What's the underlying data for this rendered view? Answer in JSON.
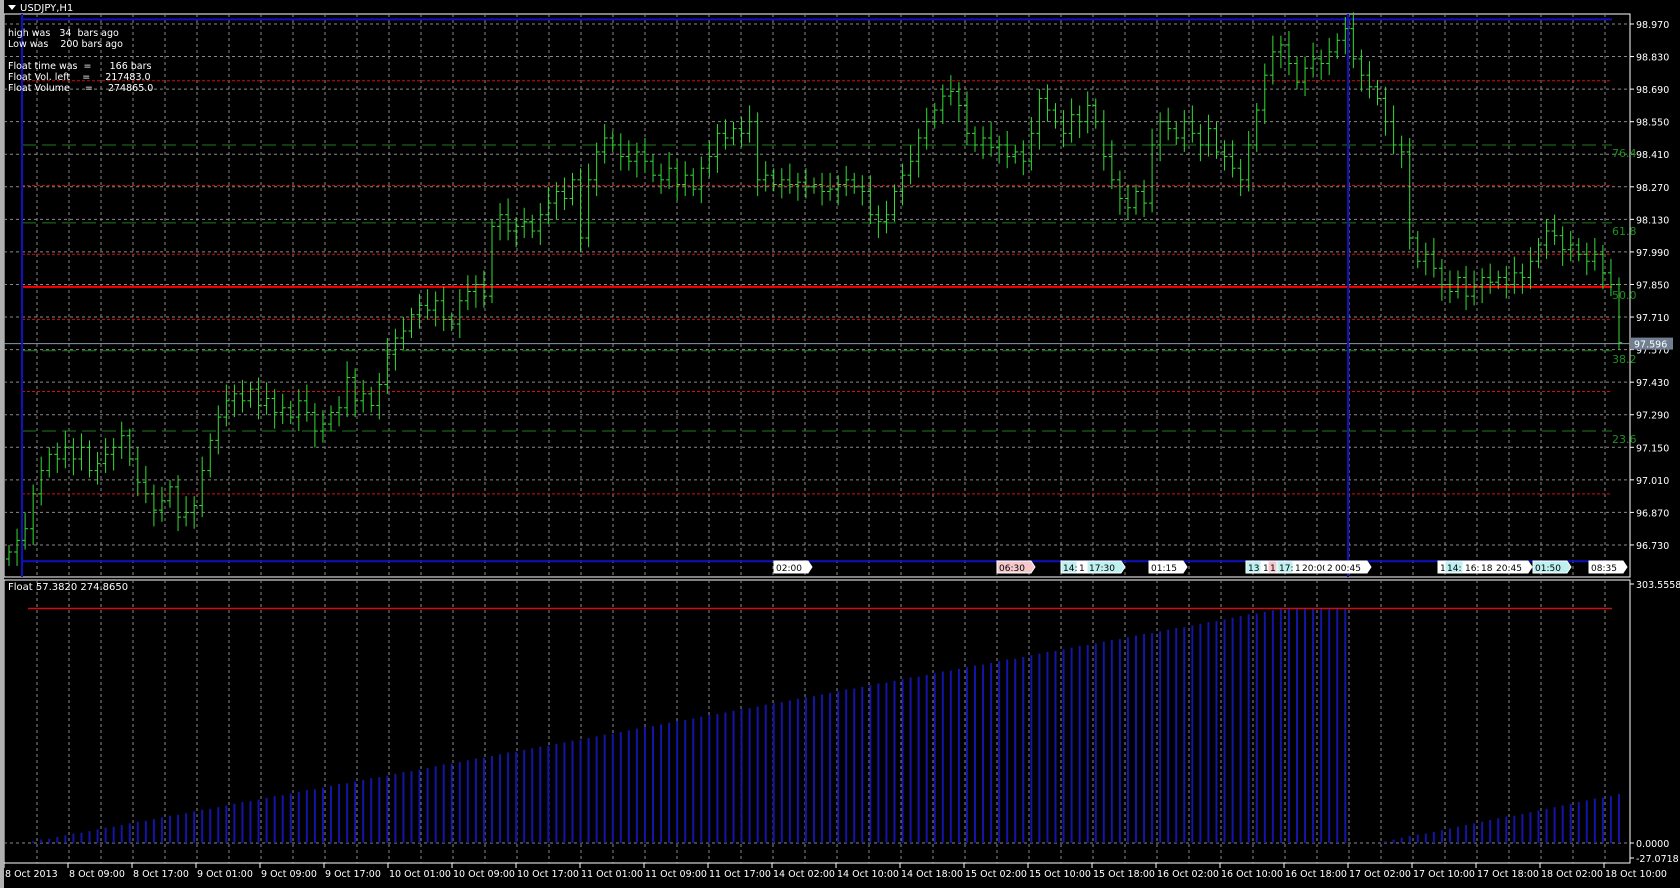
{
  "window": {
    "symbol_title": "USDJPY,H1"
  },
  "info_lines": {
    "high": "high was   34  bars ago",
    "low": "Low was    200 bars ago",
    "float_time": "Float time was  =      166 bars",
    "float_vol_left": "Float Vol. left    =     217483.0",
    "float_volume": "Float Volume     =     274865.0"
  },
  "subwindow": {
    "title": "Float 57.3820 274.8650"
  },
  "colors": {
    "background": "#000000",
    "bars": "#33dd33",
    "grid": "#8a8a8a",
    "red_level": "#cc1010",
    "main_red_line": "#ff0000",
    "fib_level": "#1f7a1f",
    "blue_line": "#1010c0",
    "histogram": "#1414a8",
    "current_price_line": "#8899aa",
    "marker_cyan": "#bff0f0",
    "marker_pink": "#f5c8cc",
    "marker_white": "#ffffff"
  },
  "chart_data": [
    {
      "type": "ohlc-line",
      "symbol": "USDJPY",
      "timeframe": "H1",
      "ylim": [
        96.73,
        98.97
      ],
      "y_ticks": [
        "98.970",
        "98.830",
        "98.690",
        "98.550",
        "98.410",
        "98.270",
        "98.130",
        "97.990",
        "97.850",
        "97.710",
        "97.570",
        "97.430",
        "97.290",
        "97.150",
        "97.010",
        "96.870",
        "96.730"
      ],
      "x_ticks": [
        "8 Oct 2013",
        "8 Oct 09:00",
        "8 Oct 17:00",
        "9 Oct 01:00",
        "9 Oct 09:00",
        "9 Oct 17:00",
        "10 Oct 01:00",
        "10 Oct 09:00",
        "10 Oct 17:00",
        "11 Oct 01:00",
        "11 Oct 09:00",
        "11 Oct 17:00",
        "14 Oct 02:00",
        "14 Oct 10:00",
        "14 Oct 18:00",
        "15 Oct 02:00",
        "15 Oct 10:00",
        "15 Oct 18:00",
        "16 Oct 02:00",
        "16 Oct 10:00",
        "16 Oct 18:00",
        "17 Oct 02:00",
        "17 Oct 10:00",
        "17 Oct 18:00",
        "18 Oct 02:00",
        "18 Oct 10:00"
      ],
      "grid": true,
      "current_price": "97.596",
      "closes": [
        96.7,
        96.75,
        96.8,
        96.95,
        97.05,
        97.12,
        97.1,
        97.15,
        97.1,
        97.15,
        97.05,
        97.08,
        97.12,
        97.15,
        97.2,
        97.1,
        97.0,
        96.95,
        96.88,
        96.92,
        96.98,
        96.85,
        96.87,
        96.9,
        97.05,
        97.18,
        97.28,
        97.35,
        97.38,
        97.35,
        97.4,
        97.33,
        97.36,
        97.3,
        97.32,
        97.28,
        97.35,
        97.3,
        97.22,
        97.25,
        97.3,
        97.32,
        97.45,
        97.35,
        97.38,
        97.33,
        97.42,
        97.55,
        97.62,
        97.65,
        97.72,
        97.76,
        97.74,
        97.78,
        97.7,
        97.68,
        97.78,
        97.82,
        97.85,
        97.8,
        98.1,
        98.15,
        98.08,
        98.1,
        98.12,
        98.08,
        98.15,
        98.2,
        98.25,
        98.22,
        98.3,
        98.05,
        98.3,
        98.42,
        98.48,
        98.45,
        98.4,
        98.38,
        98.42,
        98.38,
        98.32,
        98.3,
        98.35,
        98.28,
        98.32,
        98.26,
        98.35,
        98.4,
        98.5,
        98.48,
        98.52,
        98.5,
        98.55,
        98.3,
        98.32,
        98.28,
        98.3,
        98.28,
        98.29,
        98.27,
        98.28,
        98.25,
        98.26,
        98.28,
        98.3,
        98.27,
        98.25,
        98.15,
        98.12,
        98.15,
        98.25,
        98.32,
        98.38,
        98.48,
        98.55,
        98.6,
        98.66,
        98.68,
        98.62,
        98.5,
        98.45,
        98.48,
        98.44,
        98.45,
        98.4,
        98.42,
        98.38,
        98.5,
        98.65,
        98.6,
        98.55,
        98.5,
        98.58,
        98.55,
        98.62,
        98.55,
        98.4,
        98.3,
        98.22,
        98.18,
        98.25,
        98.2,
        98.45,
        98.55,
        98.52,
        98.48,
        98.55,
        98.5,
        98.45,
        98.52,
        98.42,
        98.4,
        98.35,
        98.3,
        98.45,
        98.6,
        98.75,
        98.85,
        98.88,
        98.8,
        98.72,
        98.78,
        98.82,
        98.8,
        98.85,
        98.9,
        98.95,
        98.82,
        98.75,
        98.7,
        98.65,
        98.55,
        98.45,
        98.42,
        98.05,
        97.95,
        97.98,
        97.92,
        97.85,
        97.82,
        97.88,
        97.8,
        97.84,
        97.88,
        97.86,
        97.88,
        97.85,
        97.9,
        97.88,
        97.95,
        98.02,
        98.08,
        98.06,
        98.0,
        98.02,
        97.98,
        97.95,
        97.98,
        97.9,
        97.85,
        97.6
      ],
      "levels": {
        "range_high": 98.99,
        "range_low": 96.66,
        "red_solid": 97.84,
        "red_dotted": [
          98.726,
          98.275,
          97.98,
          97.7,
          97.39,
          96.95
        ],
        "fib": [
          {
            "label": "76.4",
            "price": 98.45
          },
          {
            "label": "61.8",
            "price": 98.115
          },
          {
            "label": "50.0",
            "price": 97.84
          },
          {
            "label": "38.2",
            "price": 97.565
          },
          {
            "label": "23.6",
            "price": 97.22
          }
        ]
      },
      "markers": [
        {
          "text": "02:00",
          "style": "white"
        },
        {
          "text": "06:30",
          "style": "pink"
        },
        {
          "text": "14:",
          "style": "cyan"
        },
        {
          "text": "1",
          "style": "white"
        },
        {
          "text": "17:30",
          "style": "cyan"
        },
        {
          "text": "01:15",
          "style": "white"
        },
        {
          "text": "13:",
          "style": "cyan"
        },
        {
          "text": "1",
          "style": "white"
        },
        {
          "text": "1",
          "style": "pink"
        },
        {
          "text": "17:",
          "style": "cyan"
        },
        {
          "text": "1",
          "style": "white"
        },
        {
          "text": "20:00",
          "style": "white"
        },
        {
          "text": "2",
          "style": "white"
        },
        {
          "text": "00:45",
          "style": "white"
        },
        {
          "text": "1",
          "style": "white"
        },
        {
          "text": "14:",
          "style": "cyan"
        },
        {
          "text": "16:",
          "style": "white"
        },
        {
          "text": "18:",
          "style": "white"
        },
        {
          "text": "20:45",
          "style": "white"
        },
        {
          "text": "01:50",
          "style": "cyan"
        },
        {
          "text": "08:35",
          "style": "white"
        }
      ]
    },
    {
      "type": "histogram",
      "name": "Float",
      "ylim": [
        -27.0718,
        303.5558
      ],
      "y_ticks": [
        "303.5558",
        "0.0000",
        "-27.0718"
      ],
      "reference_line": 274.865,
      "values": [
        0,
        0,
        0,
        2,
        4,
        5,
        7,
        9,
        11,
        12,
        14,
        16,
        18,
        19,
        21,
        23,
        25,
        26,
        28,
        30,
        32,
        33,
        35,
        37,
        39,
        40,
        42,
        44,
        46,
        48,
        49,
        51,
        53,
        55,
        56,
        58,
        60,
        62,
        63,
        65,
        67,
        69,
        70,
        72,
        74,
        76,
        77,
        79,
        81,
        83,
        84,
        86,
        88,
        90,
        92,
        93,
        95,
        97,
        99,
        100,
        102,
        104,
        106,
        107,
        109,
        111,
        113,
        114,
        116,
        118,
        120,
        121,
        123,
        125,
        127,
        128,
        130,
        132,
        134,
        136,
        137,
        139,
        141,
        143,
        144,
        146,
        148,
        150,
        151,
        153,
        155,
        157,
        158,
        160,
        162,
        164,
        165,
        167,
        169,
        171,
        172,
        174,
        176,
        178,
        180,
        181,
        183,
        185,
        187,
        188,
        190,
        192,
        194,
        195,
        197,
        199,
        201,
        202,
        204,
        206,
        208,
        209,
        211,
        213,
        215,
        216,
        218,
        220,
        222,
        224,
        225,
        227,
        229,
        231,
        232,
        234,
        236,
        238,
        239,
        241,
        243,
        245,
        246,
        248,
        250,
        252,
        253,
        255,
        257,
        259,
        260,
        262,
        264,
        266,
        268,
        269,
        271,
        273,
        275,
        275,
        275,
        275,
        275,
        275,
        275,
        275,
        275,
        0,
        0,
        0,
        0,
        2,
        4,
        6,
        8,
        10,
        11,
        13,
        15,
        17,
        19,
        21,
        23,
        25,
        27,
        29,
        31,
        32,
        34,
        36,
        38,
        40,
        42,
        44,
        46,
        48,
        50,
        52,
        53,
        55,
        57.38
      ]
    }
  ]
}
